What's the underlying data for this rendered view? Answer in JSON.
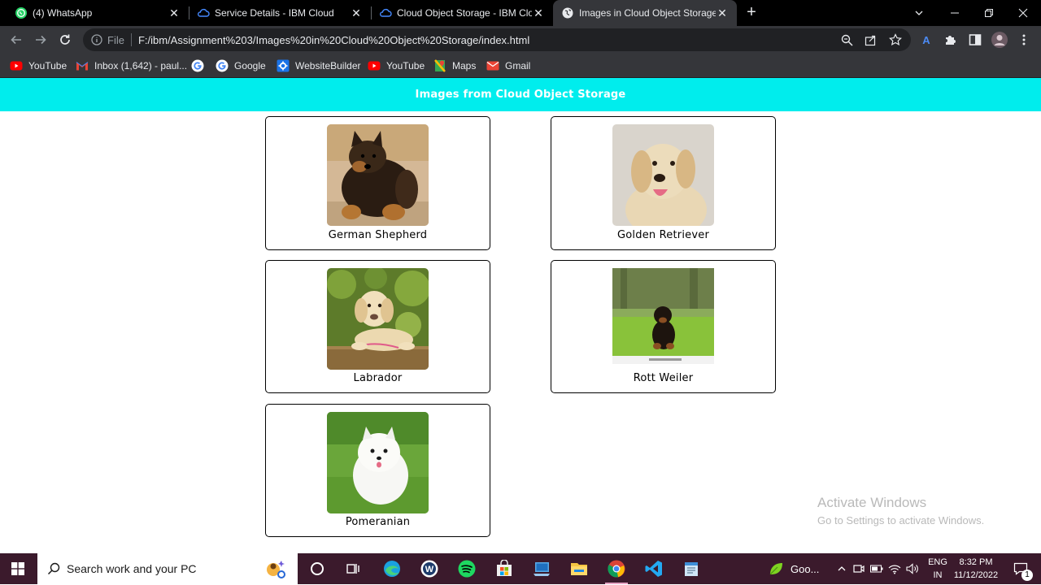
{
  "browser": {
    "tabs": [
      {
        "title": "(4) WhatsApp",
        "icon": "whatsapp-icon",
        "active": false
      },
      {
        "title": "Service Details - IBM Cloud",
        "icon": "ibm-cloud-icon",
        "active": false
      },
      {
        "title": "Cloud Object Storage - IBM Clou",
        "icon": "ibm-cloud-icon",
        "active": false
      },
      {
        "title": "Images in Cloud Object Storage",
        "icon": "globe-icon",
        "active": true
      }
    ],
    "address": {
      "scheme_label": "File",
      "url": "F:/ibm/Assignment%203/Images%20in%20Cloud%20Object%20Storage/index.html"
    },
    "bookmarks": [
      {
        "label": "YouTube",
        "icon": "youtube-icon"
      },
      {
        "label": "Inbox (1,642) - paul...",
        "icon": "gmail-icon"
      },
      {
        "label": "",
        "icon": "google-icon"
      },
      {
        "label": "Google",
        "icon": "google-icon"
      },
      {
        "label": "WebsiteBuilder",
        "icon": "gear-icon"
      },
      {
        "label": "YouTube",
        "icon": "youtube-icon"
      },
      {
        "label": "Maps",
        "icon": "maps-icon"
      },
      {
        "label": "Gmail",
        "icon": "gmail-icon"
      }
    ]
  },
  "page": {
    "header": "Images from Cloud Object Storage",
    "cards": [
      {
        "name": "German Shepherd",
        "image": "german-shepherd-puppy"
      },
      {
        "name": "Golden Retriever",
        "image": "golden-retriever-puppy"
      },
      {
        "name": "Labrador",
        "image": "labrador-puppy"
      },
      {
        "name": "Rott Weiler",
        "image": "rottweiler-puppy"
      },
      {
        "name": "Pomeranian",
        "image": "pomeranian-puppy"
      }
    ]
  },
  "watermark": {
    "title": "Activate Windows",
    "subtitle": "Go to Settings to activate Windows."
  },
  "taskbar": {
    "search_placeholder": "Search work and your PC",
    "tray_app_label": "Goo...",
    "lang_line1": "ENG",
    "lang_line2": "IN",
    "time": "8:32 PM",
    "date": "11/12/2022",
    "notification_count": "1"
  },
  "colors": {
    "header_bg": "#00eded",
    "taskbar_bg": "#3b1a2c",
    "chrome_dark": "#35363a"
  }
}
